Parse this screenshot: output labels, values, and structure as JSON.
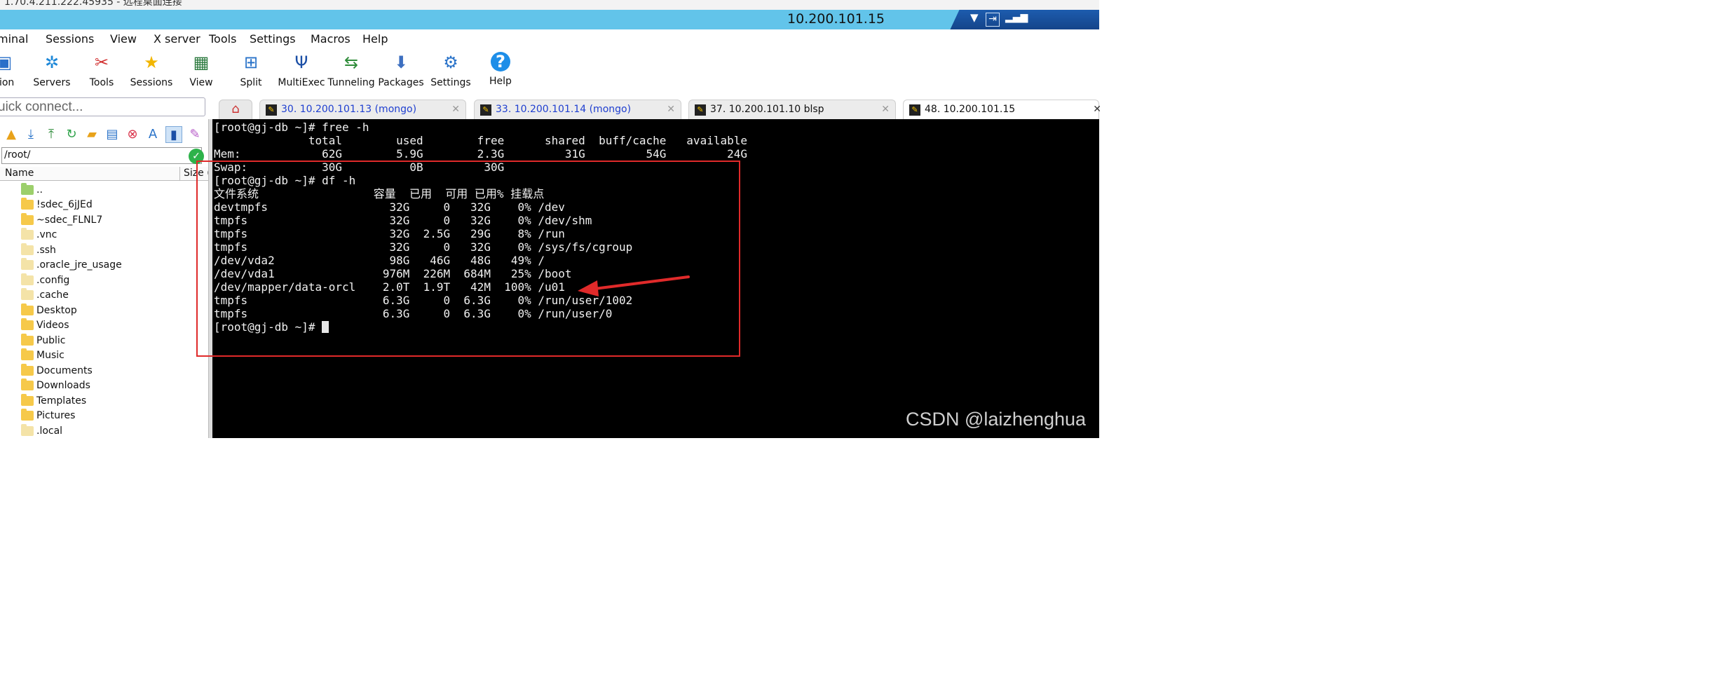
{
  "window": {
    "title_cropped": "1.70.4.211.222.45935 - 远程桌面连接",
    "session_ip": "10.200.101.15"
  },
  "menu": [
    "minal",
    "Sessions",
    "View",
    "X server",
    "Tools",
    "Settings",
    "Macros",
    "Help"
  ],
  "toolbar": [
    {
      "label": "sion",
      "icon": "session-icon"
    },
    {
      "label": "Servers",
      "icon": "servers-icon"
    },
    {
      "label": "Tools",
      "icon": "tools-icon"
    },
    {
      "label": "Sessions",
      "icon": "star-icon"
    },
    {
      "label": "View",
      "icon": "view-icon"
    },
    {
      "label": "Split",
      "icon": "split-icon"
    },
    {
      "label": "MultiExec",
      "icon": "multiexec-icon"
    },
    {
      "label": "Tunneling",
      "icon": "tunneling-icon"
    },
    {
      "label": "Packages",
      "icon": "packages-icon"
    },
    {
      "label": "Settings",
      "icon": "gear-icon"
    },
    {
      "label": "Help",
      "icon": "help-icon"
    }
  ],
  "quick_connect": {
    "placeholder": "uick connect..."
  },
  "tabs": [
    {
      "label": "30. 10.200.101.13 (mongo)",
      "color": "#1f3fd0"
    },
    {
      "label": "33. 10.200.101.14 (mongo)",
      "color": "#1f3fd0"
    },
    {
      "label": "37. 10.200.101.10 blsp",
      "color": "#111111"
    },
    {
      "label": "48. 10.200.101.15",
      "color": "#111111"
    }
  ],
  "file_panel": {
    "path": "/root/",
    "col_name": "Name",
    "col_size": "Size (",
    "items": [
      "..",
      "!sdec_6jJEd",
      "~sdec_FLNL7",
      ".vnc",
      ".ssh",
      ".oracle_jre_usage",
      ".config",
      ".cache",
      "Desktop",
      "Videos",
      "Public",
      "Music",
      "Documents",
      "Downloads",
      "Templates",
      "Pictures",
      ".local"
    ]
  },
  "terminal": {
    "lines": [
      "[root@gj-db ~]# free -h",
      "              total        used        free      shared  buff/cache   available",
      "Mem:            62G        5.9G        2.3G         31G         54G         24G",
      "Swap:           30G          0B         30G",
      "[root@gj-db ~]# df -h",
      "文件系统                 容量  已用  可用 已用% 挂载点",
      "devtmpfs                  32G     0   32G    0% /dev",
      "tmpfs                     32G     0   32G    0% /dev/shm",
      "tmpfs                     32G  2.5G   29G    8% /run",
      "tmpfs                     32G     0   32G    0% /sys/fs/cgroup",
      "/dev/vda2                 98G   46G   48G   49% /",
      "/dev/vda1                976M  226M  684M   25% /boot",
      "/dev/mapper/data-orcl    2.0T  1.9T   42M  100% /u01",
      "tmpfs                    6.3G     0  6.3G    0% /run/user/1002",
      "tmpfs                    6.3G     0  6.3G    0% /run/user/0",
      "[root@gj-db ~]# "
    ]
  },
  "watermark": "CSDN @laizhenghua",
  "colors": {
    "session_bar": "#62c4ea",
    "annotation": "#e02a2a",
    "terminal_bg": "#000000"
  }
}
